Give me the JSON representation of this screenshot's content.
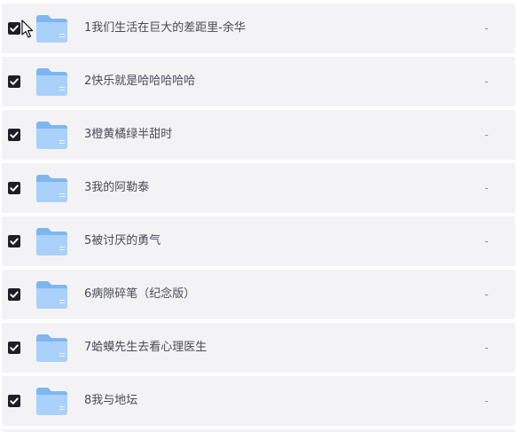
{
  "files": [
    {
      "name": "1我们生活在巨大的差距里-余华",
      "size": "-",
      "checked": true
    },
    {
      "name": "2快乐就是哈哈哈哈哈",
      "size": "-",
      "checked": true
    },
    {
      "name": "3橙黄橘绿半甜时",
      "size": "-",
      "checked": true
    },
    {
      "name": "3我的阿勒泰",
      "size": "-",
      "checked": true
    },
    {
      "name": "5被讨厌的勇气",
      "size": "-",
      "checked": true
    },
    {
      "name": "6病隙碎笔（纪念版）",
      "size": "-",
      "checked": true
    },
    {
      "name": "7蛤蟆先生去看心理医生",
      "size": "-",
      "checked": true
    },
    {
      "name": "8我与地坛",
      "size": "-",
      "checked": true
    }
  ],
  "icons": {
    "checkbox": "checkbox-checked-icon",
    "folder": "folder-icon",
    "cursor": "mouse-pointer-icon"
  },
  "colors": {
    "row_bg": "#f3f3f6",
    "checkbox": "#1e1e24",
    "folder_back": "#7fb6ef",
    "folder_front": "#a9d1fa"
  }
}
